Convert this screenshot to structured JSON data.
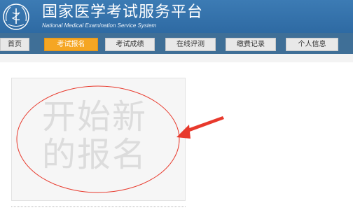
{
  "header": {
    "title": "国家医学考试服务平台",
    "subtitle": "National Medical Examination Service System",
    "logo_icon": "medical-caduceus-emblem"
  },
  "nav": {
    "items": [
      {
        "label": "首页",
        "active": false
      },
      {
        "label": "考试报名",
        "active": true
      },
      {
        "label": "考试成绩",
        "active": false
      },
      {
        "label": "在线评测",
        "active": false
      },
      {
        "label": "缴费记录",
        "active": false
      },
      {
        "label": "个人信息",
        "active": false
      }
    ]
  },
  "main": {
    "new_registration_line1": "开始新",
    "new_registration_line2": "的报名"
  },
  "annotation": {
    "color": "#e8392c"
  },
  "colors": {
    "header_blue": "#3c7bb4",
    "nav_blue": "#3f6f97",
    "active_orange": "#f5a623"
  }
}
